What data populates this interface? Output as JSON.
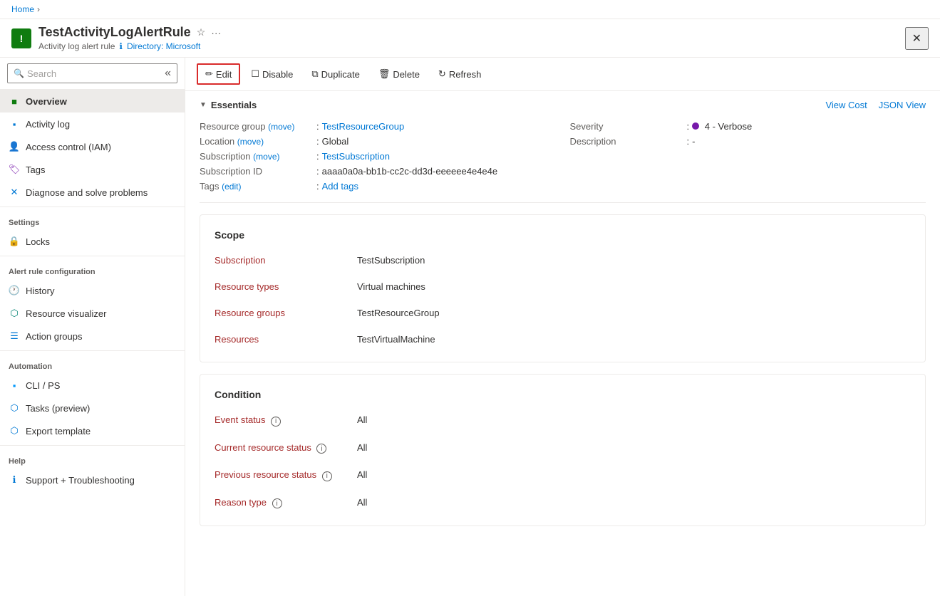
{
  "breadcrumb": {
    "home": "Home",
    "separator": "›"
  },
  "header": {
    "icon_text": "!",
    "title": "TestActivityLogAlertRule",
    "subtitle_type": "Activity log alert rule",
    "info_icon": "ℹ",
    "directory_label": "Directory: Microsoft",
    "close_label": "✕"
  },
  "toolbar": {
    "edit_label": "Edit",
    "disable_label": "Disable",
    "duplicate_label": "Duplicate",
    "delete_label": "Delete",
    "refresh_label": "Refresh"
  },
  "sidebar": {
    "search_placeholder": "Search",
    "items": [
      {
        "id": "overview",
        "label": "Overview",
        "active": true
      },
      {
        "id": "activity-log",
        "label": "Activity log"
      },
      {
        "id": "access-control",
        "label": "Access control (IAM)"
      },
      {
        "id": "tags",
        "label": "Tags"
      },
      {
        "id": "diagnose",
        "label": "Diagnose and solve problems"
      }
    ],
    "settings_label": "Settings",
    "settings_items": [
      {
        "id": "locks",
        "label": "Locks"
      }
    ],
    "alert_config_label": "Alert rule configuration",
    "alert_config_items": [
      {
        "id": "history",
        "label": "History"
      },
      {
        "id": "resource-visualizer",
        "label": "Resource visualizer"
      },
      {
        "id": "action-groups",
        "label": "Action groups"
      }
    ],
    "automation_label": "Automation",
    "automation_items": [
      {
        "id": "cli-ps",
        "label": "CLI / PS"
      },
      {
        "id": "tasks-preview",
        "label": "Tasks (preview)"
      },
      {
        "id": "export-template",
        "label": "Export template"
      }
    ],
    "help_label": "Help",
    "help_items": [
      {
        "id": "support",
        "label": "Support + Troubleshooting"
      }
    ]
  },
  "essentials": {
    "section_title": "Essentials",
    "view_cost": "View Cost",
    "json_view": "JSON View",
    "fields": {
      "resource_group_label": "Resource group",
      "resource_group_move": "(move)",
      "resource_group_value": "TestResourceGroup",
      "location_label": "Location",
      "location_move": "(move)",
      "location_value": "Global",
      "subscription_label": "Subscription",
      "subscription_move": "(move)",
      "subscription_value": "TestSubscription",
      "subscription_id_label": "Subscription ID",
      "subscription_id_value": "aaaa0a0a-bb1b-cc2c-dd3d-eeeeee4e4e4e",
      "tags_label": "Tags",
      "tags_edit": "(edit)",
      "tags_value": "Add tags",
      "severity_label": "Severity",
      "severity_value": "4 - Verbose",
      "description_label": "Description",
      "description_value": "-"
    }
  },
  "scope_card": {
    "title": "Scope",
    "fields": [
      {
        "label": "Subscription",
        "value": "TestSubscription"
      },
      {
        "label": "Resource types",
        "value": "Virtual machines"
      },
      {
        "label": "Resource groups",
        "value": "TestResourceGroup"
      },
      {
        "label": "Resources",
        "value": "TestVirtualMachine"
      }
    ]
  },
  "condition_card": {
    "title": "Condition",
    "fields": [
      {
        "label": "Event status",
        "value": "All",
        "has_info": true
      },
      {
        "label": "Current resource status",
        "value": "All",
        "has_info": true
      },
      {
        "label": "Previous resource status",
        "value": "All",
        "has_info": true
      },
      {
        "label": "Reason type",
        "value": "All",
        "has_info": true
      }
    ]
  }
}
